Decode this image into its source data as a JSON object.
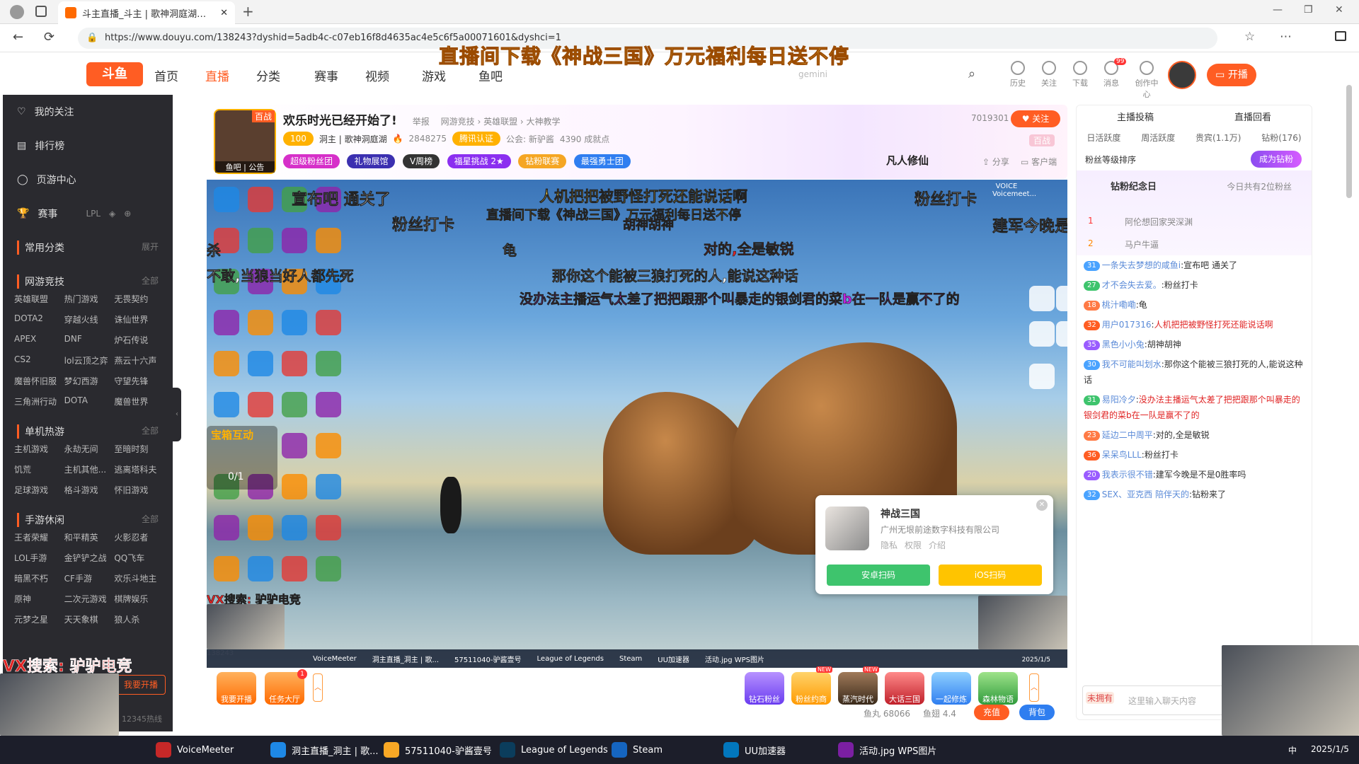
{
  "browser": {
    "tab_title": "斗主直播_斗主 | 歌神洞庭湖直播...",
    "url": "https://www.douyu.com/138243?dyshid=5adb4c-c07eb16f8d4635ac4e5c6f5a00071601&dyshci=1"
  },
  "site": {
    "logo": "斗鱼",
    "nav": [
      "首页",
      "直播",
      "分类",
      "赛事",
      "视频",
      "游戏",
      "鱼吧"
    ],
    "banner": "直播间下载《神战三国》万元福利每日送不停",
    "search_label": "gemini",
    "header_icons": [
      "历史",
      "关注",
      "下载",
      "消息",
      "创作中心"
    ],
    "msg_badge": "99",
    "open_btn": "开播"
  },
  "sidebar": {
    "items": [
      "我的关注",
      "排行榜",
      "页游中心",
      "赛事"
    ],
    "sections": [
      {
        "title": "常用分类",
        "more": "展开",
        "games": []
      },
      {
        "title": "网游竞技",
        "more": "全部",
        "games": [
          "英雄联盟",
          "热门游戏",
          "无畏契约",
          "DOTA2",
          "穿越火线",
          "诛仙世界",
          "APEX",
          "DNF",
          "炉石传说",
          "CS2",
          "lol云顶之弈",
          "燕云十六声",
          "魔兽怀旧服",
          "梦幻西游",
          "守望先锋",
          "三角洲行动",
          "DOTA",
          "魔兽世界"
        ]
      },
      {
        "title": "单机热游",
        "more": "全部",
        "games": [
          "主机游戏",
          "永劫无间",
          "至暗时刻",
          "饥荒",
          "主机其他...",
          "逃离塔科夫",
          "足球游戏",
          "格斗游戏",
          "怀旧游戏"
        ]
      },
      {
        "title": "手游休闲",
        "more": "全部",
        "games": [
          "王者荣耀",
          "和平精英",
          "火影忍者",
          "LOL手游",
          "金铲铲之战",
          "QQ飞车",
          "暗黑不朽",
          "CF手游",
          "欢乐斗地主",
          "原神",
          "二次元游戏",
          "棋牌娱乐",
          "元梦之星",
          "天天象棋",
          "狼人杀"
        ]
      }
    ],
    "start_live": "我要开播",
    "hotline": "12345热线"
  },
  "room": {
    "title": "欢乐时光已经开始了!",
    "report": "举报",
    "breadcrumb": [
      "网游竞技",
      "英雄联盟",
      "大神教学"
    ],
    "followers": "7019301",
    "follow_btn": "关注",
    "streamer": "洞主 | 歌神洞庭湖",
    "hot": "2848275",
    "cert": "腾讯认证",
    "guild": "公会: 新驴酱",
    "fish": "4390 成就点",
    "tags": [
      "超级粉丝团",
      "礼物展馆",
      "V周榜",
      "福星挑战 2★",
      "钻粉联赛",
      "最强勇士团"
    ],
    "share": "分享",
    "client": "客户端",
    "poster": "鱼吧 | 公告",
    "game_logo": "凡人修仙",
    "lvl": "100",
    "avatar_badge": "百战",
    "header_badge": "百战"
  },
  "video": {
    "danmu": [
      {
        "t": "宣布吧 通关了",
        "c": "#ffffff"
      },
      {
        "t": "人机把把被野怪打死还能说话啊",
        "c": "#ffd94a"
      },
      {
        "t": "直播间下载《神战三国》万元福利每日送不停",
        "c": "#ffd94a"
      },
      {
        "t": "胡神胡神",
        "c": "#e02424"
      },
      {
        "t": "粉丝打卡",
        "c": "#ffffff"
      },
      {
        "t": "粉丝打卡",
        "c": "#ffffff"
      },
      {
        "t": "建军今晚是",
        "c": "#ffffff"
      },
      {
        "t": "龟",
        "c": "#ffffff"
      },
      {
        "t": "对的,全是敏锐",
        "c": "#e02424"
      },
      {
        "t": "不敢,当狼当好人都先死",
        "c": "#ffffff"
      },
      {
        "t": "那你这个能被三狼打死的人,能说这种话",
        "c": "#ffffff"
      },
      {
        "t": "没办法主播运气太差了把把跟那个叫暴走的银剑君的菜b在一队是赢不了的",
        "c": "#c020e0"
      },
      {
        "t": "杀",
        "c": "#ffffff"
      },
      {
        "t": "VX搜索: 驴驴电竞",
        "c": "#e02424"
      }
    ],
    "box_title": "宝箱互动",
    "box_count": "0/1",
    "popup": {
      "name": "神战三国",
      "company": "广州无垠前途数字科技有限公司",
      "links": [
        "隐私",
        "权限",
        "介绍"
      ],
      "android": "安卓扫码",
      "ios": "iOS扫码"
    },
    "taskbar": [
      "VoiceMeeter",
      "洞主直播_洞主 | 歌...",
      "57511040-驴酱壹号",
      "League of Legends",
      "Steam",
      "UU加速器",
      "活动.jpg WPS图片"
    ],
    "date": "2025/1/5",
    "room_num": "138243",
    "voice_label": "VOICE",
    "voice_label_2": "Voicemeet..."
  },
  "bottom": {
    "items": [
      "我要开播",
      "任务大厅",
      "钻石粉丝",
      "粉丝约商",
      "蒸汽时代",
      "大话三国",
      "一起修炼",
      "森林物语"
    ],
    "fish_balls": "鱼丸 68066",
    "fish_wings": "鱼翅 4.4",
    "recharge": "充值",
    "bag": "背包",
    "new_tag": "NEW",
    "new_tag_2": "NEW",
    "task_badge": "1"
  },
  "chat": {
    "tabs_top": [
      "主播投稿",
      "直播回看"
    ],
    "tabs": [
      "日活跃度",
      "周活跃度",
      "贵宾(1.1万)",
      "钻粉(176)"
    ],
    "fan_rank": "粉丝等级排序",
    "become_diamond": "成为钻粉",
    "diamond_day": "钻粉纪念日",
    "diamond_count": "今日共有2位粉丝",
    "rank": [
      {
        "n": "1",
        "name": "阿伦想回家哭深渊"
      },
      {
        "n": "2",
        "name": "马户牛逼"
      }
    ],
    "messages": [
      {
        "lv": "31",
        "name": "一条失去梦想的咸鱼i",
        "text": "宣布吧 通关了"
      },
      {
        "lv": "27",
        "name": "才不会失去爱。",
        "text": "粉丝打卡"
      },
      {
        "lv": "18",
        "name": "桃汁嘞嘞",
        "text": "龟"
      },
      {
        "lv": "32",
        "name": "用户017316",
        "text": "人机把把被野怪打死还能说话啊"
      },
      {
        "lv": "35",
        "name": "黑色小小兔",
        "text": "胡神胡神"
      },
      {
        "lv": "30",
        "name": "我不可能叫划水",
        "text": "那你这个能被三狼打死的人,能说这种话"
      },
      {
        "lv": "31",
        "name": "易阳冷夕",
        "text": "没办法主播运气太差了把把跟那个叫暴走的银剑君的菜b在一队是赢不了的"
      },
      {
        "lv": "23",
        "name": "延边二中周平",
        "text": "对的,全是敏锐"
      },
      {
        "lv": "36",
        "name": "呆呆鸟LLL",
        "text": "粉丝打卡"
      },
      {
        "lv": "20",
        "name": "我表示很不错",
        "text": "建军今晚是不是0胜率吗"
      },
      {
        "lv": "32",
        "name": "SEX、亚克西 陪伴天的",
        "text": "钻粉来了"
      }
    ],
    "input_placeholder": "这里输入聊天内容",
    "not_owned": "未拥有"
  },
  "watermark": "VX搜索: 驴驴电竞",
  "win_taskbar": {
    "items": [
      "VoiceMeeter",
      "洞主直播_洞主 | 歌...",
      "57511040-驴酱壹号",
      "League of Legends",
      "Steam",
      "UU加速器",
      "活动.jpg WPS图片"
    ],
    "date": "2025/1/5",
    "clock_label": "中"
  },
  "colors": {
    "brand": "#ff5d23",
    "sidebar_bg": "#2a2a2f",
    "taskbar_bg": "#1c1e2a"
  }
}
